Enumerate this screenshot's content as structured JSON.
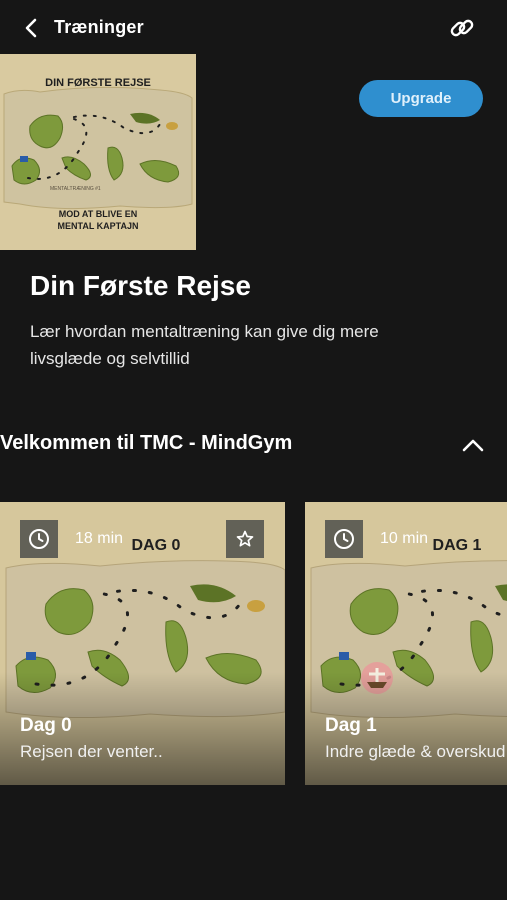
{
  "header": {
    "title": "Træninger",
    "back_icon": "chevron-left-icon",
    "share_icon": "link-icon"
  },
  "cover": {
    "map_title": "DIN FØRSTE REJSE",
    "caption": "MOD AT BLIVE EN MENTAL KAPTAJN",
    "watermark": "MENTALTRÆNING #1"
  },
  "upgrade_label": "Upgrade",
  "program": {
    "title": "Din Første Rejse",
    "description": "Lær hvordan mentaltræning kan give dig mere livsglæde og selvtillid"
  },
  "section": {
    "title": "Velkommen til TMC - MindGym",
    "toggle_icon": "chevron-up-icon"
  },
  "cards": [
    {
      "duration": "18 min",
      "map_label": "DAG 0",
      "day": "Dag 0",
      "description": "Rejsen der venter..",
      "icons": [
        "clock-icon",
        "star-icon"
      ]
    },
    {
      "duration": "10 min",
      "map_label": "DAG 1",
      "day": "Dag 1",
      "description": "Indre glæde & overskud",
      "icons": [
        "clock-icon"
      ]
    }
  ],
  "colors": {
    "background": "#161616",
    "accent": "#2f8fcf",
    "parchment": "#d9caa0",
    "island": "#7e9a3c"
  }
}
